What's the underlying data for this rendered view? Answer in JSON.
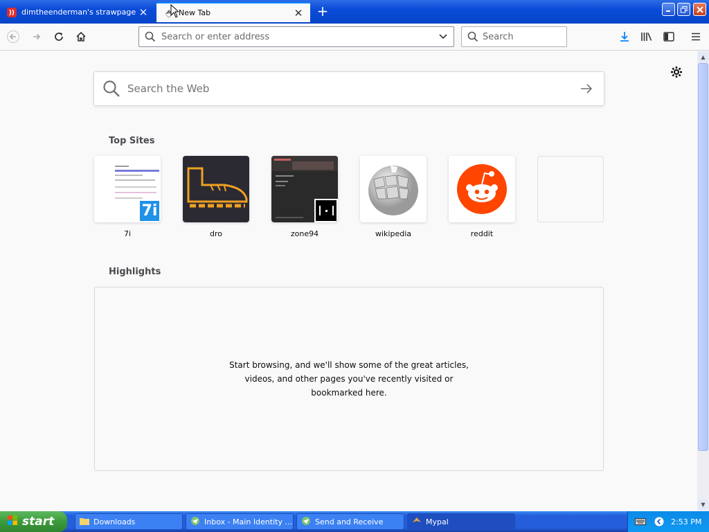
{
  "browser": {
    "tabs": [
      {
        "title": "dimtheenderman's strawpage",
        "active": false
      },
      {
        "title": "New Tab",
        "active": true
      }
    ],
    "urlbar_placeholder": "Search or enter address",
    "searchbar_placeholder": "Search"
  },
  "newtab": {
    "web_search_placeholder": "Search the Web",
    "top_sites_title": "Top Sites",
    "top_sites": [
      {
        "label": "7i"
      },
      {
        "label": "dro"
      },
      {
        "label": "zone94"
      },
      {
        "label": "wikipedia"
      },
      {
        "label": "reddit"
      },
      {
        "label": ""
      }
    ],
    "highlights_title": "Highlights",
    "highlights_message": "Start browsing, and we'll show some of the great articles, videos, and other pages you've recently visited or bookmarked here.",
    "tile_text": {
      "seven_i": "7i"
    }
  },
  "taskbar": {
    "start_label": "start",
    "items": [
      {
        "label": "Downloads"
      },
      {
        "label": "Inbox - Main Identity ..."
      },
      {
        "label": "Send and Receive"
      },
      {
        "label": "Mypal"
      }
    ],
    "clock": "2:53 PM"
  },
  "colors": {
    "accent": "#0a84ff",
    "reddit": "#ff4500",
    "titlebar": "#0a4bd8",
    "taskbar": "#245edb",
    "start_green": "#3c9a3c"
  }
}
